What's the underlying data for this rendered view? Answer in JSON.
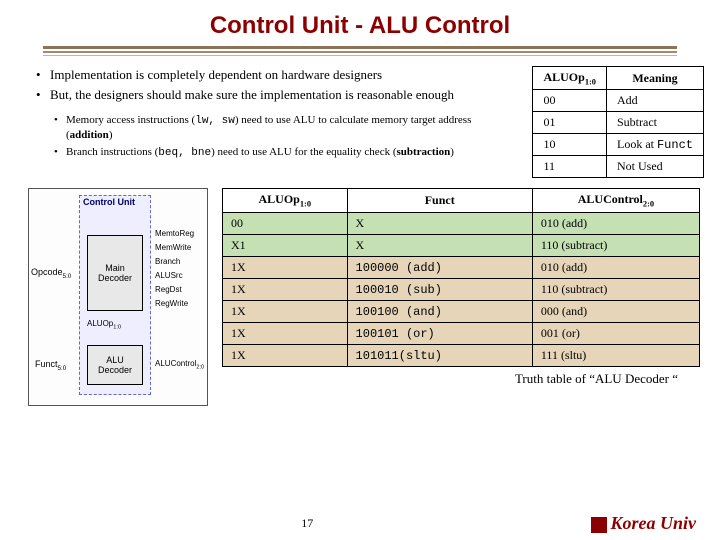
{
  "title": "Control Unit - ALU Control",
  "bullets": [
    "Implementation is completely dependent on hardware designers",
    "But, the designers should make sure the implementation is reasonable enough"
  ],
  "sub_bullets": [
    {
      "pre": "Memory access instructions (",
      "mono": "lw, sw",
      "mid": ") need to use ALU to calculate memory target address (",
      "bold": "addition",
      "post": ")"
    },
    {
      "pre": "Branch instructions (",
      "mono": "beq, bne",
      "mid": ") need to use ALU for the equality check (",
      "bold": "subtraction",
      "post": ")"
    }
  ],
  "small_table": {
    "headers": [
      "ALUOp",
      "Meaning"
    ],
    "header_sub": "1:0",
    "rows": [
      [
        "00",
        "Add"
      ],
      [
        "01",
        "Subtract"
      ],
      [
        "10",
        "Look at Funct"
      ],
      [
        "11",
        "Not Used"
      ]
    ]
  },
  "diagram": {
    "cu": "Control\nUnit",
    "main": "Main\nDecoder",
    "alu": "ALU\nDecoder",
    "opcode": "Opcode",
    "opcode_sub": "5:0",
    "funct": "Funct",
    "funct_sub": "5:0",
    "aluop": "ALUOp",
    "aluop_sub": "1:0",
    "aluctrl": "ALUControl",
    "aluctrl_sub": "2:0",
    "sigs": [
      "MemtoReg",
      "MemWrite",
      "Branch",
      "ALUSrc",
      "RegDst",
      "RegWrite"
    ]
  },
  "big_table": {
    "headers": [
      "ALUOp",
      "Funct",
      "ALUControl"
    ],
    "header_subs": [
      "1:0",
      "",
      "2:0"
    ],
    "rows": [
      {
        "c": "green",
        "v": [
          "00",
          "X",
          "010 (add)"
        ]
      },
      {
        "c": "green",
        "v": [
          "X1",
          "X",
          "110 (subtract)"
        ]
      },
      {
        "c": "tan",
        "v": [
          "1X",
          "100000 (add)",
          "010 (add)"
        ]
      },
      {
        "c": "tan",
        "v": [
          "1X",
          "100010 (sub)",
          "110 (subtract)"
        ]
      },
      {
        "c": "tan",
        "v": [
          "1X",
          "100100 (and)",
          "000 (and)"
        ]
      },
      {
        "c": "tan",
        "v": [
          "1X",
          "100101 (or)",
          "001 (or)"
        ]
      },
      {
        "c": "tan",
        "v": [
          "1X",
          "101011(sltu)",
          "111 (sltu)"
        ]
      }
    ]
  },
  "caption": "Truth table of  “ALU Decoder “",
  "page_num": "17",
  "university": "Korea Univ"
}
